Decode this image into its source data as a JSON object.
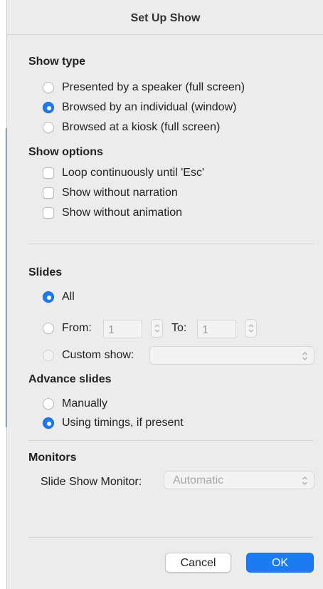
{
  "dialog": {
    "title": "Set Up Show"
  },
  "show_type": {
    "heading": "Show type",
    "options": [
      {
        "label": "Presented by a speaker (full screen)",
        "selected": false
      },
      {
        "label": "Browsed by an individual (window)",
        "selected": true
      },
      {
        "label": "Browsed at a kiosk (full screen)",
        "selected": false
      }
    ]
  },
  "show_options": {
    "heading": "Show options",
    "options": [
      {
        "label": "Loop continuously until 'Esc'",
        "checked": false
      },
      {
        "label": "Show without narration",
        "checked": false
      },
      {
        "label": "Show without animation",
        "checked": false
      }
    ]
  },
  "slides": {
    "heading": "Slides",
    "all_label": "All",
    "all_selected": true,
    "from_label": "From:",
    "from_value": "1",
    "to_label": "To:",
    "to_value": "1",
    "custom_label": "Custom show:",
    "custom_value": ""
  },
  "advance_slides": {
    "heading": "Advance slides",
    "options": [
      {
        "label": "Manually",
        "selected": false
      },
      {
        "label": "Using timings, if present",
        "selected": true
      }
    ]
  },
  "monitors": {
    "heading": "Monitors",
    "label": "Slide Show Monitor:",
    "value": "Automatic"
  },
  "buttons": {
    "cancel": "Cancel",
    "ok": "OK"
  },
  "colors": {
    "accent": "#1a7bf2",
    "background": "#ececec"
  }
}
